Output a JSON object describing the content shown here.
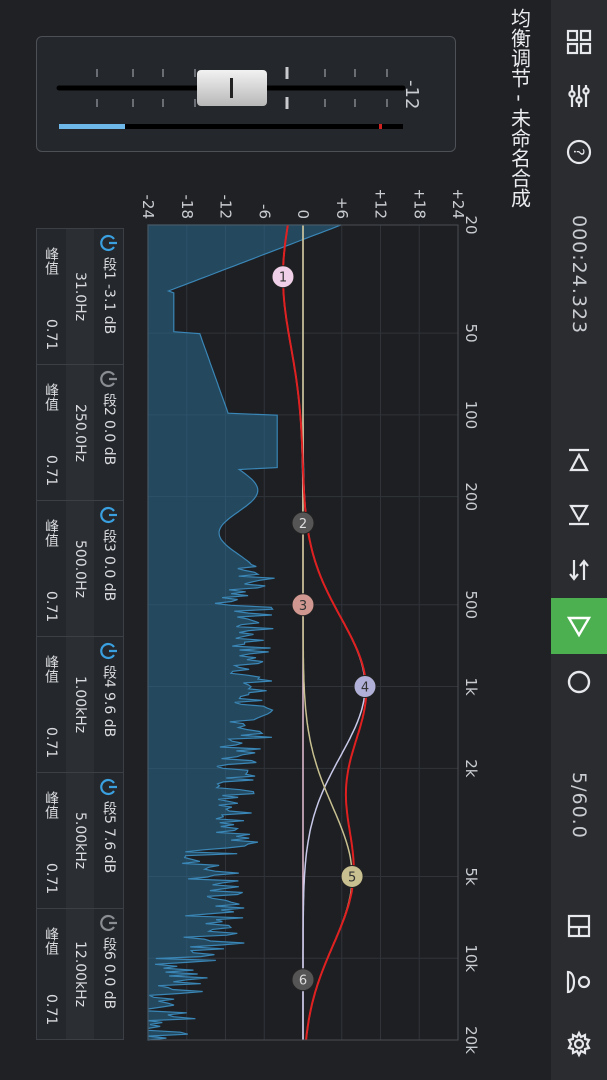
{
  "app": {
    "title": "均衡调节 - 未命名合成",
    "time": "000:24.323",
    "frame": "5/60.0"
  },
  "toolbar": {
    "icons": [
      "grid-icon",
      "sliders-icon",
      "help-icon",
      "skip-start-icon",
      "skip-end-icon",
      "loop-icon",
      "play-icon",
      "record-icon",
      "panel-icon",
      "user-icon",
      "settings-icon"
    ]
  },
  "gain": {
    "value": "-12",
    "level": 0.18
  },
  "axis": {
    "db_ticks": [
      "-24",
      "-18",
      "-12",
      "-6",
      "0",
      "+6",
      "+12",
      "+18",
      "+24"
    ],
    "freq_ticks": [
      "20",
      "50",
      "100",
      "200",
      "500",
      "1k",
      "2k",
      "5k",
      "10k",
      "20k"
    ]
  },
  "bands": [
    {
      "name": "段1",
      "gain": "-3.1 dB",
      "freq": "31.0Hz",
      "type": "峰值",
      "q": "0.71",
      "enabled": true,
      "color": "#f0d0e8"
    },
    {
      "name": "段2",
      "gain": "0.0 dB",
      "freq": "250.0Hz",
      "type": "峰值",
      "q": "0.71",
      "enabled": false,
      "color": "#555555"
    },
    {
      "name": "段3",
      "gain": "0.0 dB",
      "freq": "500.0Hz",
      "type": "峰值",
      "q": "0.71",
      "enabled": true,
      "color": "#d09890"
    },
    {
      "name": "段4",
      "gain": "9.6 dB",
      "freq": "1.00kHz",
      "type": "峰值",
      "q": "0.71",
      "enabled": true,
      "color": "#b0b0d8"
    },
    {
      "name": "段5",
      "gain": "7.6 dB",
      "freq": "5.00kHz",
      "type": "峰值",
      "q": "0.71",
      "enabled": true,
      "color": "#c8c090"
    },
    {
      "name": "段6",
      "gain": "0.0 dB",
      "freq": "12.00kHz",
      "type": "峰值",
      "q": "0.71",
      "enabled": false,
      "color": "#555555"
    }
  ],
  "colors": {
    "accent": "#4caf50",
    "curve": "#e02020",
    "spectrum": "#2a6a90",
    "power_on": "#3aa0e0"
  }
}
